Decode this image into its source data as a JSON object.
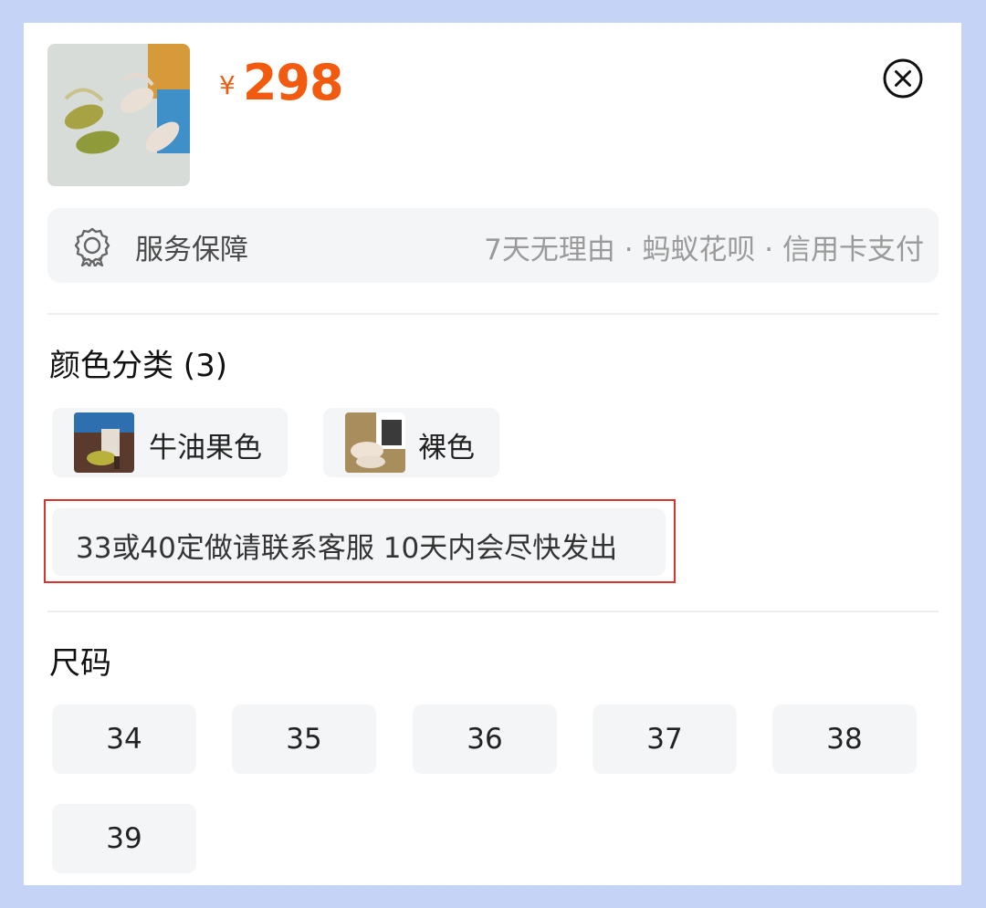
{
  "product": {
    "currency": "¥",
    "price": "298",
    "thumbnail_icon": "sandals-photo"
  },
  "service": {
    "icon": "badge-ribbon-icon",
    "title": "服务保障",
    "description": "7天无理由 · 蚂蚁花呗 · 信用卡支付"
  },
  "color_section": {
    "title": "颜色分类 (3)",
    "options": [
      {
        "label": "牛油果色",
        "icon": "sandal-photo-avocado"
      },
      {
        "label": "裸色",
        "icon": "sandal-photo-nude"
      },
      {
        "label": "33或40定做请联系客服 10天内会尽快发出"
      }
    ]
  },
  "size_section": {
    "title": "尺码",
    "sizes": [
      "34",
      "35",
      "36",
      "37",
      "38",
      "39"
    ]
  },
  "colors": {
    "price": "#f15a0f",
    "highlight_border": "#d9342b",
    "option_bg": "#f4f5f7",
    "background": "#c5d4f6"
  }
}
